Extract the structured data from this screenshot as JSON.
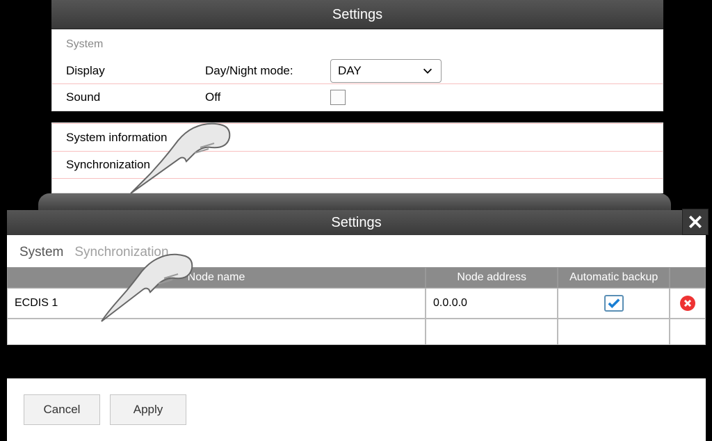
{
  "top": {
    "title": "Settings",
    "sidebar_system": "System",
    "display_label": "Display",
    "daynight_label": "Day/Night mode:",
    "daynight_value": "DAY",
    "sound_label": "Sound",
    "sound_value": "Off",
    "sysinfo_label": "System information",
    "sync_label": "Synchronization"
  },
  "dialog": {
    "title": "Settings",
    "crumb1": "System",
    "crumb2": "Synchronization",
    "col_node_name": "Node name",
    "col_node_addr": "Node address",
    "col_backup": "Automatic backup",
    "row1": {
      "name": "ECDIS 1",
      "addr": "0.0.0.0",
      "backup": true
    },
    "cancel": "Cancel",
    "apply": "Apply"
  }
}
